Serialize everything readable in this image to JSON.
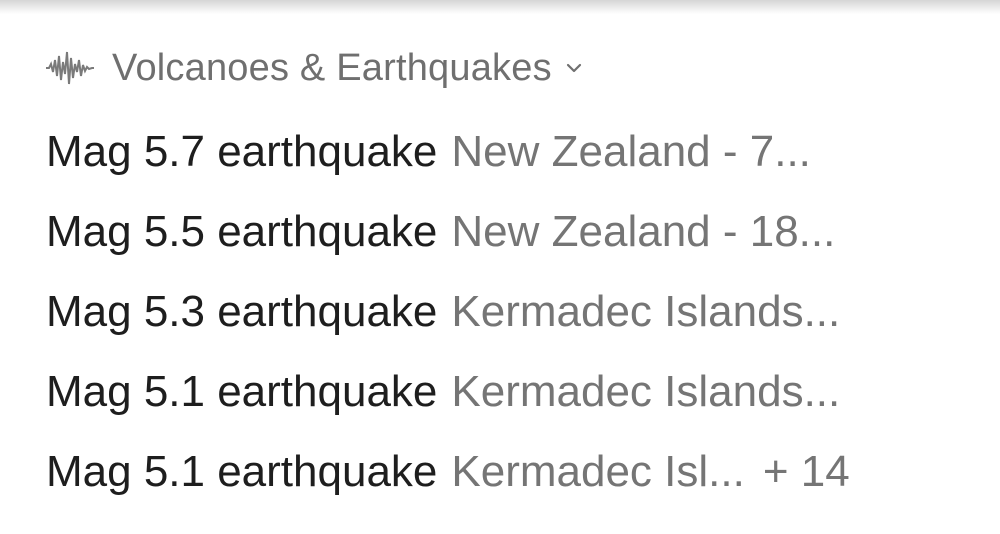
{
  "card": {
    "category": {
      "icon": "seismograph-icon",
      "title": "Volcanoes & Earthquakes",
      "chevron": "chevron-down-icon"
    },
    "items": [
      {
        "title": "Mag 5.7 earthquake",
        "subtitle": "New Zealand - 7..."
      },
      {
        "title": "Mag 5.5 earthquake",
        "subtitle": "New Zealand - 18..."
      },
      {
        "title": "Mag 5.3 earthquake",
        "subtitle": "Kermadec Islands..."
      },
      {
        "title": "Mag 5.1 earthquake",
        "subtitle": "Kermadec Islands..."
      },
      {
        "title": "Mag 5.1 earthquake",
        "subtitle": "Kermadec Isl...",
        "more": "+ 14"
      }
    ]
  }
}
